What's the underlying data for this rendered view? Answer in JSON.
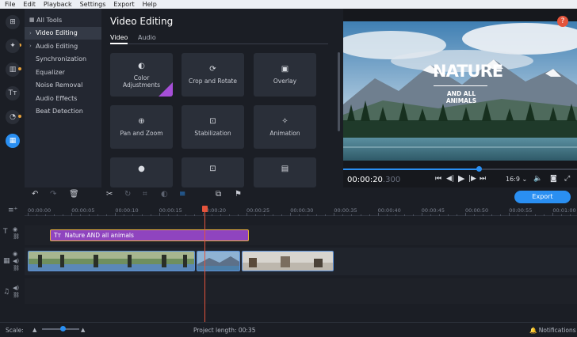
{
  "menu": [
    "File",
    "Edit",
    "Playback",
    "Settings",
    "Export",
    "Help"
  ],
  "categories": {
    "all_tools": "All Tools",
    "items": [
      {
        "label": "Video Editing",
        "active": true,
        "chevron": "›"
      },
      {
        "label": "Audio Editing",
        "active": false,
        "chevron": "›"
      },
      {
        "label": "Synchronization"
      },
      {
        "label": "Equalizer"
      },
      {
        "label": "Noise Removal"
      },
      {
        "label": "Audio Effects"
      },
      {
        "label": "Beat Detection"
      }
    ]
  },
  "tools": {
    "title": "Video Editing",
    "tabs": [
      "Video",
      "Audio"
    ],
    "active_tab": "Video",
    "tiles": [
      {
        "label_line1": "Color",
        "label_line2": "Adjustments",
        "icon": "color-adjust-icon"
      },
      {
        "label_line1": "Crop and Rotate",
        "label_line2": "",
        "icon": "crop-icon"
      },
      {
        "label_line1": "Overlay",
        "label_line2": "",
        "icon": "overlay-icon"
      },
      {
        "label_line1": "Pan and Zoom",
        "label_line2": "",
        "icon": "zoom-icon"
      },
      {
        "label_line1": "Stabilization",
        "label_line2": "",
        "icon": "stabilization-icon"
      },
      {
        "label_line1": "Animation",
        "label_line2": "",
        "icon": "animation-icon"
      }
    ]
  },
  "preview": {
    "title_big": "NATURE",
    "title_small": "AND ALL ANIMALS",
    "help": "?",
    "timecode": "00:00:20",
    "timecode_ms": ".300",
    "aspect": "16:9",
    "progress": 0.58
  },
  "timeline": {
    "export_label": "Export",
    "ruler": [
      "00:00:00",
      "00:00:05",
      "00:00:10",
      "00:00:15",
      "00:00:20",
      "00:00:25",
      "00:00:30",
      "00:00:35",
      "00:00:40",
      "00:00:45",
      "00:00:50",
      "00:00:55",
      "00:01:00"
    ],
    "title_clip": "Nature AND all animals",
    "title_clip_icon": "Tт"
  },
  "status": {
    "scale_label": "Scale:",
    "project_length": "Project length:  00:35",
    "notifications": "Notifications"
  },
  "colors": {
    "accent": "#2a8ff2",
    "title_clip": "#8f44bf",
    "playhead": "#e4543c"
  }
}
